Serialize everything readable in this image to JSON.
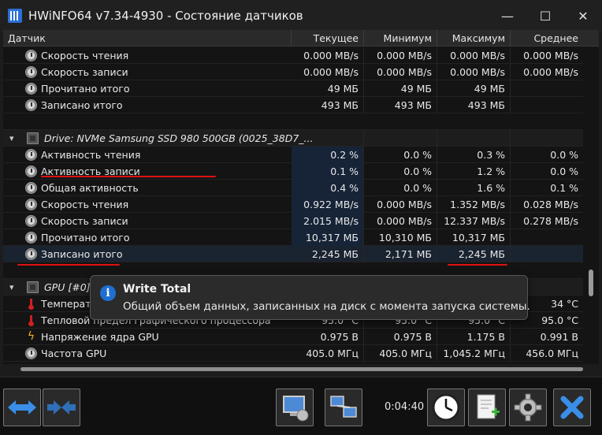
{
  "window": {
    "title": "HWiNFO64 v7.34-4930 - Состояние датчиков",
    "minimize_glyph": "—",
    "maximize_glyph": "☐",
    "close_glyph": "✕"
  },
  "columns": {
    "sensor": "Датчик",
    "current": "Текущее",
    "min": "Минимум",
    "max": "Максимум",
    "avg": "Среднее"
  },
  "rows": [
    {
      "name": "Скорость чтения",
      "icon": "clock-icon",
      "cur": "0.000 MB/s",
      "min": "0.000 MB/s",
      "max": "0.000 MB/s",
      "avg": "0.000 MB/s"
    },
    {
      "name": "Скорость записи",
      "icon": "clock-icon",
      "cur": "0.000 MB/s",
      "min": "0.000 MB/s",
      "max": "0.000 MB/s",
      "avg": "0.000 MB/s"
    },
    {
      "name": "Прочитано итого",
      "icon": "clock-icon",
      "cur": "49 МБ",
      "min": "49 МБ",
      "max": "49 МБ",
      "avg": ""
    },
    {
      "name": "Записано итого",
      "icon": "clock-icon",
      "cur": "493 МБ",
      "min": "493 МБ",
      "max": "493 МБ",
      "avg": ""
    },
    {
      "name": "Drive: NVMe Samsung SSD 980 500GB (0025_38D7_..."
    },
    {
      "name": "Активность чтения",
      "icon": "clock-icon",
      "cur": "0.2 %",
      "min": "0.0 %",
      "max": "0.3 %",
      "avg": "0.0 %"
    },
    {
      "name": "Активность записи",
      "icon": "clock-icon",
      "cur": "0.1 %",
      "min": "0.0 %",
      "max": "1.2 %",
      "avg": "0.0 %"
    },
    {
      "name": "Общая активность",
      "icon": "clock-icon",
      "cur": "0.4 %",
      "min": "0.0 %",
      "max": "1.6 %",
      "avg": "0.1 %"
    },
    {
      "name": "Скорость чтения",
      "icon": "clock-icon",
      "cur": "0.922 MB/s",
      "min": "0.000 MB/s",
      "max": "1.352 MB/s",
      "avg": "0.028 MB/s"
    },
    {
      "name": "Скорость записи",
      "icon": "clock-icon",
      "cur": "2.015 MB/s",
      "min": "0.000 MB/s",
      "max": "12.337 MB/s",
      "avg": "0.278 MB/s"
    },
    {
      "name": "Прочитано итого",
      "icon": "clock-icon",
      "cur": "10,317 МБ",
      "min": "10,310 МБ",
      "max": "10,317 МБ",
      "avg": ""
    },
    {
      "name": "Записано итого",
      "icon": "clock-icon",
      "cur": "2,245 МБ",
      "min": "2,171 МБ",
      "max": "2,245 МБ",
      "avg": ""
    },
    {
      "name": "GPU [#0]:"
    },
    {
      "name": "Температура",
      "icon": "thermometer-icon",
      "cur": "",
      "min": "",
      "max": "",
      "avg": "34 °C"
    },
    {
      "name": "Тепловой предел графического процессора",
      "icon": "thermometer-icon",
      "cur": "95.0 °C",
      "min": "95.0 °C",
      "max": "95.0 °C",
      "avg": "95.0 °C"
    },
    {
      "name": "Напряжение ядра GPU",
      "icon": "lightning-icon",
      "cur": "0.975 В",
      "min": "0.975 В",
      "max": "1.175 В",
      "avg": "0.991 В"
    },
    {
      "name": "Частота GPU",
      "icon": "clock-icon",
      "cur": "405.0 МГц",
      "min": "405.0 МГц",
      "max": "1,045.2 МГц",
      "avg": "456.0 МГц"
    }
  ],
  "tooltip": {
    "icon_glyph": "i",
    "title": "Write Total",
    "text": "Общий объем данных, записанных на диск с момента запуска системы."
  },
  "toolbar": {
    "timer": "0:04:40"
  },
  "colors": {
    "accent_blue": "#1e6fd0",
    "annotation_red": "#e01010",
    "selected_bg": "#1a2330"
  }
}
